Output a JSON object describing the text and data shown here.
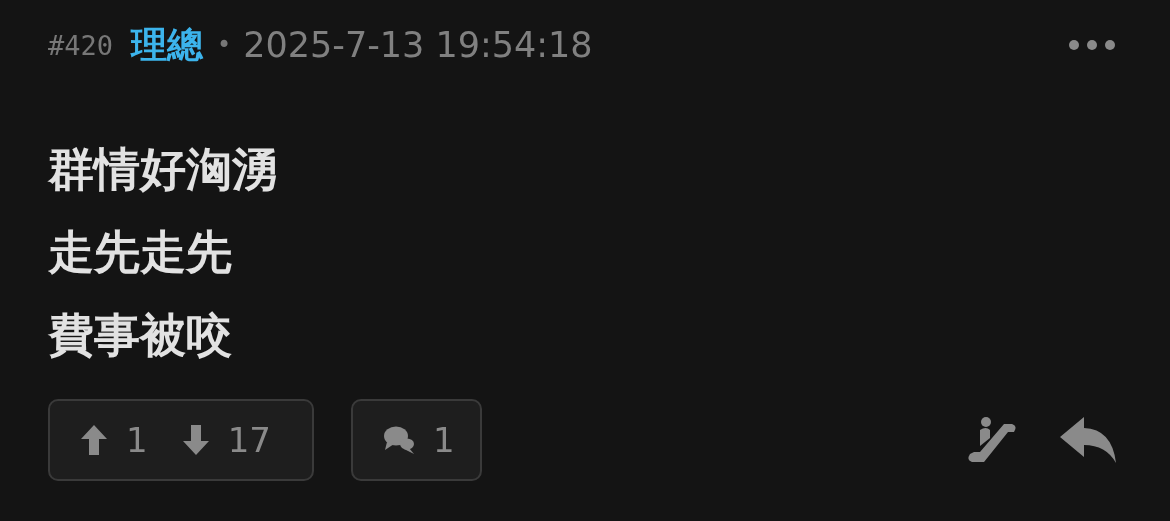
{
  "post": {
    "number": "#420",
    "author": "理總",
    "separator": "•",
    "timestamp": "2025-7-13 19:54:18"
  },
  "body": [
    "群情好洶湧",
    "走先走先",
    "費事被咬"
  ],
  "votes": {
    "up": "1",
    "down": "17"
  },
  "comments": {
    "count": "1"
  }
}
